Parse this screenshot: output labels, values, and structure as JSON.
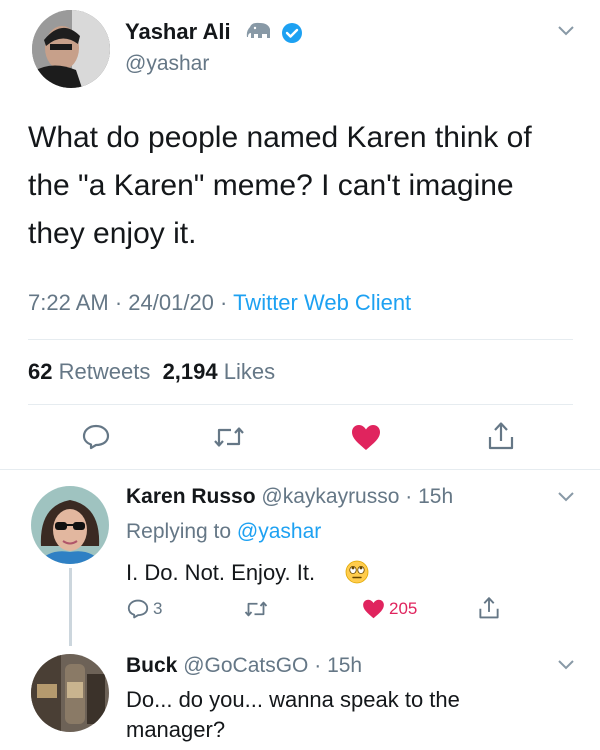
{
  "tweet": {
    "author_name": "Yashar Ali",
    "author_handle": "@yashar",
    "text_line1": "What do people named Karen think of",
    "text_line2": "the \"a Karen\" meme? I can't imagine",
    "text_line3": "they enjoy it.",
    "time": "7:22 AM",
    "date": "24/01/20",
    "source": "Twitter Web Client",
    "retweet_count": "62",
    "retweet_label": "Retweets",
    "like_count": "2,194",
    "like_label": "Likes"
  },
  "replies": [
    {
      "name": "Karen Russo",
      "handle": "@kaykayrusso",
      "age": "15h",
      "replying_label": "Replying to",
      "replying_handle": "@yashar",
      "text": "I. Do. Not. Enjoy. It.",
      "reply_count": "3",
      "like_count": "205"
    },
    {
      "name": "Buck",
      "handle": "@GoCatsGO",
      "age": "15h",
      "text_line1": "Do... do you... wanna speak to the",
      "text_line2": "manager?"
    }
  ],
  "colors": {
    "accent": "#1da1f2",
    "like": "#e0245e",
    "muted": "#657786",
    "text": "#14171a",
    "divider": "#e6ecf0"
  },
  "icons": [
    "elephant-icon",
    "verified-badge-icon",
    "chevron-down-icon",
    "reply-icon",
    "retweet-icon",
    "heart-icon",
    "share-icon",
    "eye-roll-emoji-icon"
  ]
}
